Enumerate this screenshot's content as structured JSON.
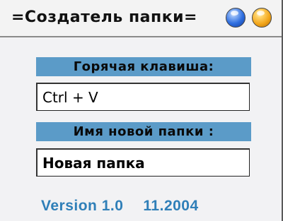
{
  "window": {
    "title": "=Создатель папки="
  },
  "title_buttons": [
    {
      "icon": "blue-orb-icon",
      "color": "#2f6fe0"
    },
    {
      "icon": "orange-orb-icon",
      "color": "#f1a418"
    }
  ],
  "hotkey": {
    "label": "Горячая клавиша:",
    "value": "Ctrl + V"
  },
  "folder_name": {
    "label": "Имя новой папки :",
    "value": "Новая папка"
  },
  "footer": {
    "version": "Version 1.0",
    "date": "11.2004"
  },
  "colors": {
    "label_bar": "#5b9bc8",
    "version_text": "#2f7fb8"
  }
}
